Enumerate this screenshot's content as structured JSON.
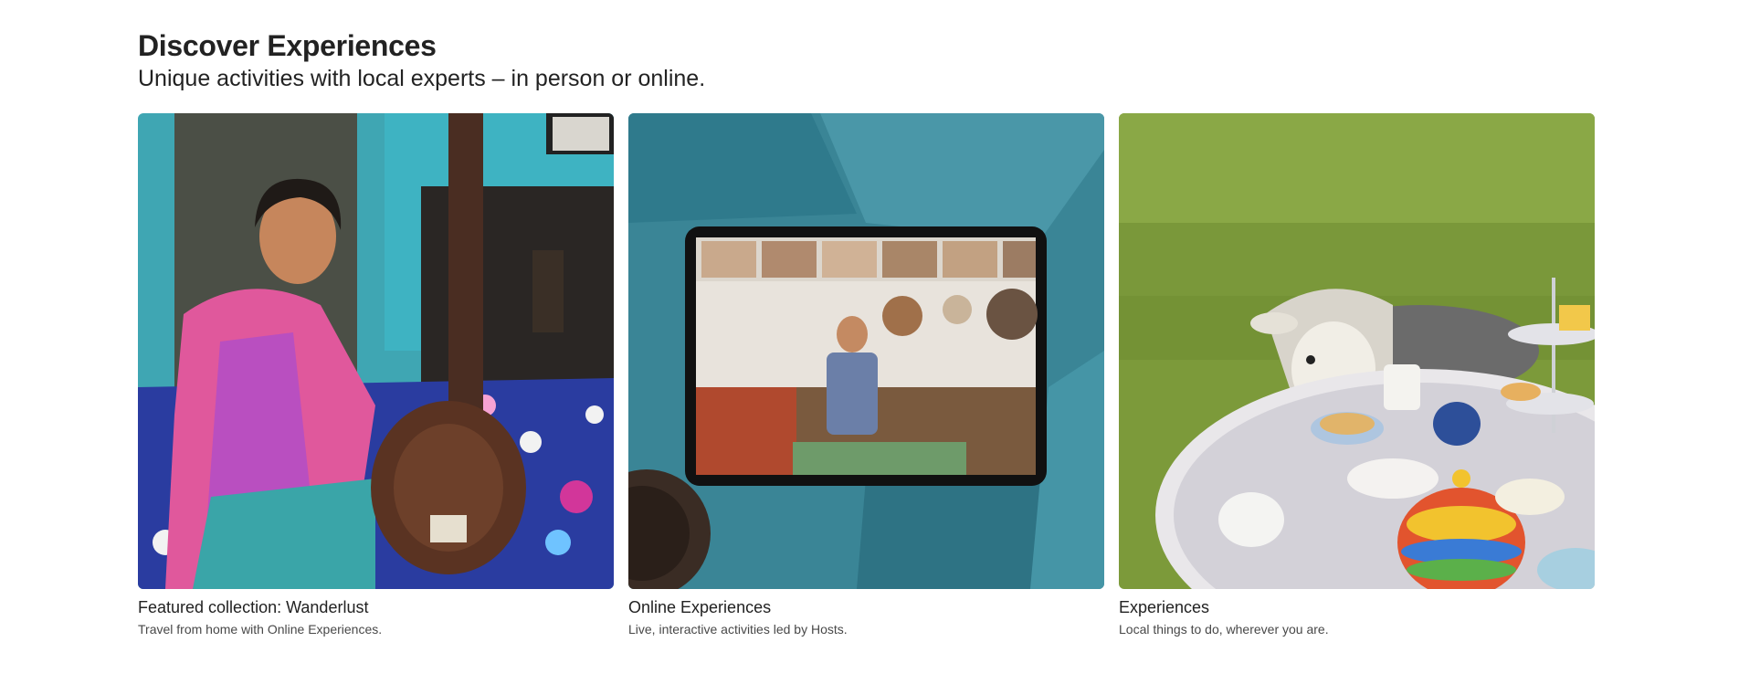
{
  "header": {
    "title": "Discover Experiences",
    "subtitle": "Unique activities with local experts – in person or online."
  },
  "cards": [
    {
      "title": "Featured collection: Wanderlust",
      "description": "Travel from home with Online Experiences.",
      "image": "woman-with-tanpura-photo"
    },
    {
      "title": "Online Experiences",
      "description": "Live, interactive activities led by Hosts.",
      "image": "tablet-video-call-photo"
    },
    {
      "title": "Experiences",
      "description": "Local things to do, wherever you are.",
      "image": "sheep-tea-party-photo"
    }
  ]
}
